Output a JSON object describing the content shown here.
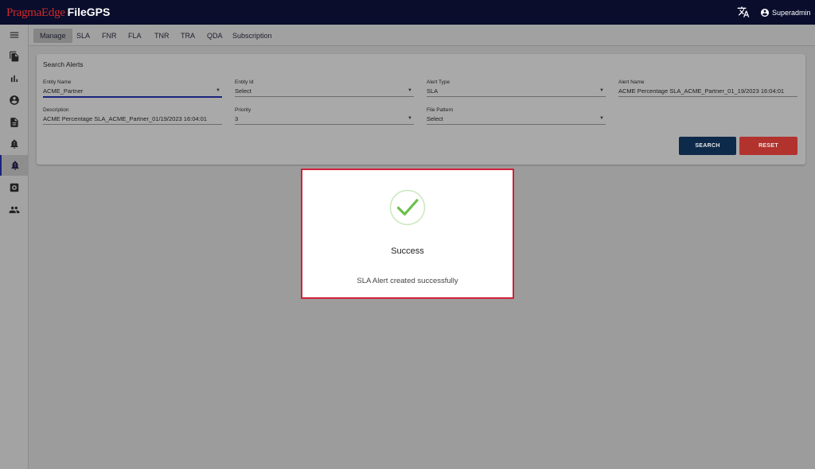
{
  "brand": {
    "primary": "PragmaEdge",
    "product": "FileGPS"
  },
  "header": {
    "user_name": "Superadmin",
    "icons": [
      "translate-icon",
      "account-circle-icon"
    ]
  },
  "sidebar": {
    "items": [
      {
        "icon": "menu-icon"
      },
      {
        "icon": "files-icon"
      },
      {
        "icon": "bar-chart-icon"
      },
      {
        "icon": "account-icon"
      },
      {
        "icon": "document-icon"
      },
      {
        "icon": "alert-bell-icon"
      },
      {
        "icon": "alert-bell-active-icon",
        "active": true
      },
      {
        "icon": "settings-box-icon"
      },
      {
        "icon": "people-icon"
      }
    ]
  },
  "tabs": [
    "Manage",
    "SLA",
    "FNR",
    "FLA",
    "TNR",
    "TRA",
    "QDA",
    "Subscription"
  ],
  "active_tab": "Manage",
  "search": {
    "title": "Search Alerts",
    "fields": [
      {
        "label": "Entity Name",
        "value": "ACME_Partner"
      },
      {
        "label": "Entity Id",
        "value": "Select"
      },
      {
        "label": "Alert Type",
        "value": "SLA"
      },
      {
        "label": "Alert Name",
        "value": "ACME Percentage SLA_ACME_Partner_01_19/2023 16:04:01"
      },
      {
        "label": "Description",
        "value": "ACME Percentage SLA_ACME_Partner_01/19/2023 16:04:01"
      },
      {
        "label": "Priority",
        "value": "3"
      },
      {
        "label": "File Pattern",
        "value": "Select"
      }
    ],
    "search_label": "SEARCH",
    "reset_label": "RESET"
  },
  "dialog": {
    "title": "Success",
    "message": "SLA Alert created successfully"
  },
  "colors": {
    "topbar": "#0a0d2c",
    "brand_red": "#d62828",
    "search_button": "#0e2a4a",
    "reset_button": "#b2322e",
    "success_green": "#6dbf4b",
    "dialog_highlight": "#d0213a"
  }
}
